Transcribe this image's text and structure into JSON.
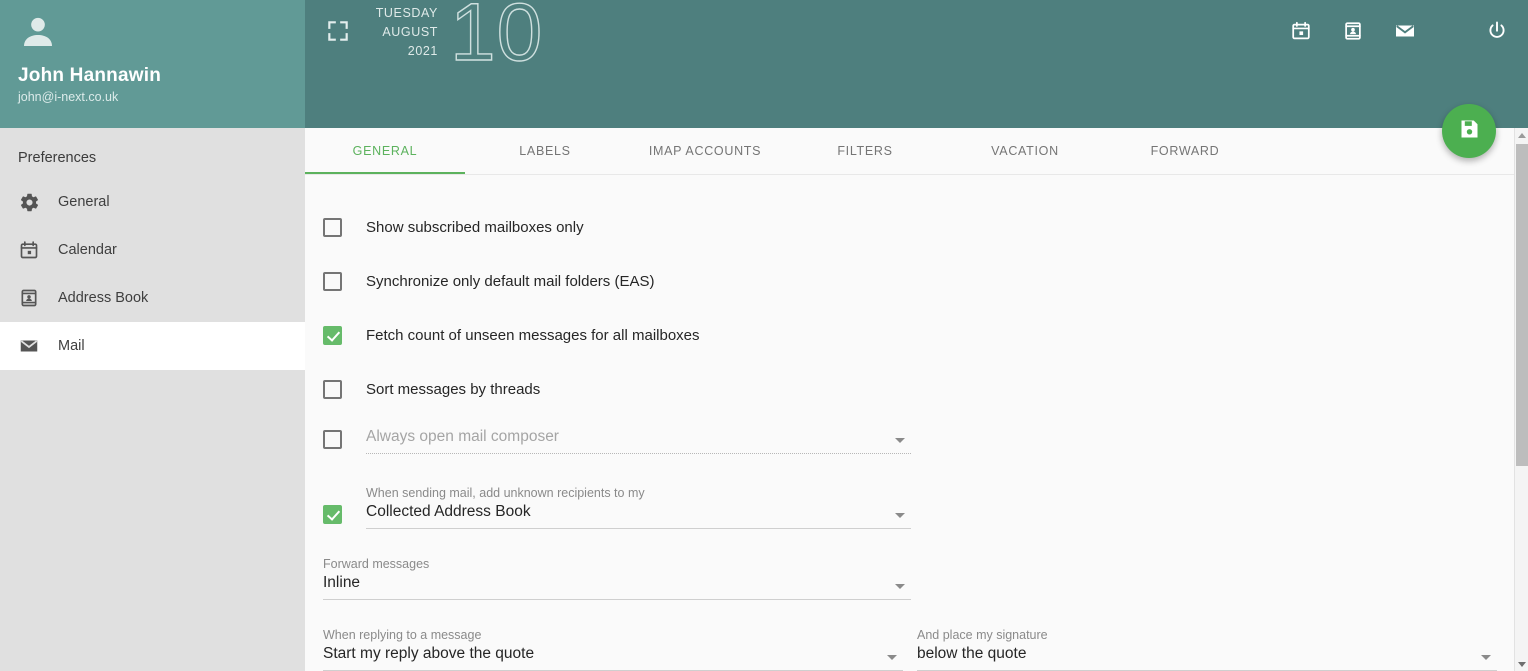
{
  "profile": {
    "name": "John Hannawin",
    "email": "john@i-next.co.uk",
    "avatar_icon": "person-icon"
  },
  "header": {
    "fullscreen_icon": "fullscreen-icon",
    "weekday": "TUESDAY",
    "month": "AUGUST",
    "year": "2021",
    "day": "10",
    "actions": [
      {
        "icon": "calendar-icon",
        "name": "calendar-button"
      },
      {
        "icon": "address-book-icon",
        "name": "address-book-button"
      },
      {
        "icon": "mail-icon",
        "name": "mail-button"
      },
      {
        "icon": "power-icon",
        "name": "logout-button"
      }
    ],
    "background_color": "#4e7f7e",
    "profile_background_color": "#619a96"
  },
  "sidebar": {
    "section_title": "Preferences",
    "items": [
      {
        "label": "General",
        "icon": "gear-icon",
        "active": false
      },
      {
        "label": "Calendar",
        "icon": "calendar-icon",
        "active": false
      },
      {
        "label": "Address Book",
        "icon": "address-book-icon",
        "active": false
      },
      {
        "label": "Mail",
        "icon": "mail-icon",
        "active": true
      }
    ]
  },
  "tabs": [
    {
      "label": "GENERAL",
      "active": true
    },
    {
      "label": "LABELS",
      "active": false
    },
    {
      "label": "IMAP ACCOUNTS",
      "active": false
    },
    {
      "label": "FILTERS",
      "active": false
    },
    {
      "label": "VACATION",
      "active": false
    },
    {
      "label": "FORWARD",
      "active": false
    }
  ],
  "settings": {
    "checkboxes": [
      {
        "label": "Show subscribed mailboxes only",
        "checked": false
      },
      {
        "label": "Synchronize only default mail folders (EAS)",
        "checked": false
      },
      {
        "label": "Fetch count of unseen messages for all mailboxes",
        "checked": true
      },
      {
        "label": "Sort messages by threads",
        "checked": false
      }
    ],
    "composer": {
      "checked": false,
      "placeholder": "Always open mail composer",
      "value": "",
      "disabled": true
    },
    "unknown_recipients": {
      "checked": true,
      "caption": "When sending mail, add unknown recipients to my",
      "value": "Collected Address Book"
    },
    "forward_messages": {
      "caption": "Forward messages",
      "value": "Inline"
    },
    "reply_mode": {
      "caption": "When replying to a message",
      "value": "Start my reply above the quote"
    },
    "signature_placement": {
      "caption": "And place my signature",
      "value": "below the quote"
    }
  },
  "save_button": {
    "icon": "save-icon",
    "color": "#4caf50"
  },
  "accent_color": "#5cb25d"
}
